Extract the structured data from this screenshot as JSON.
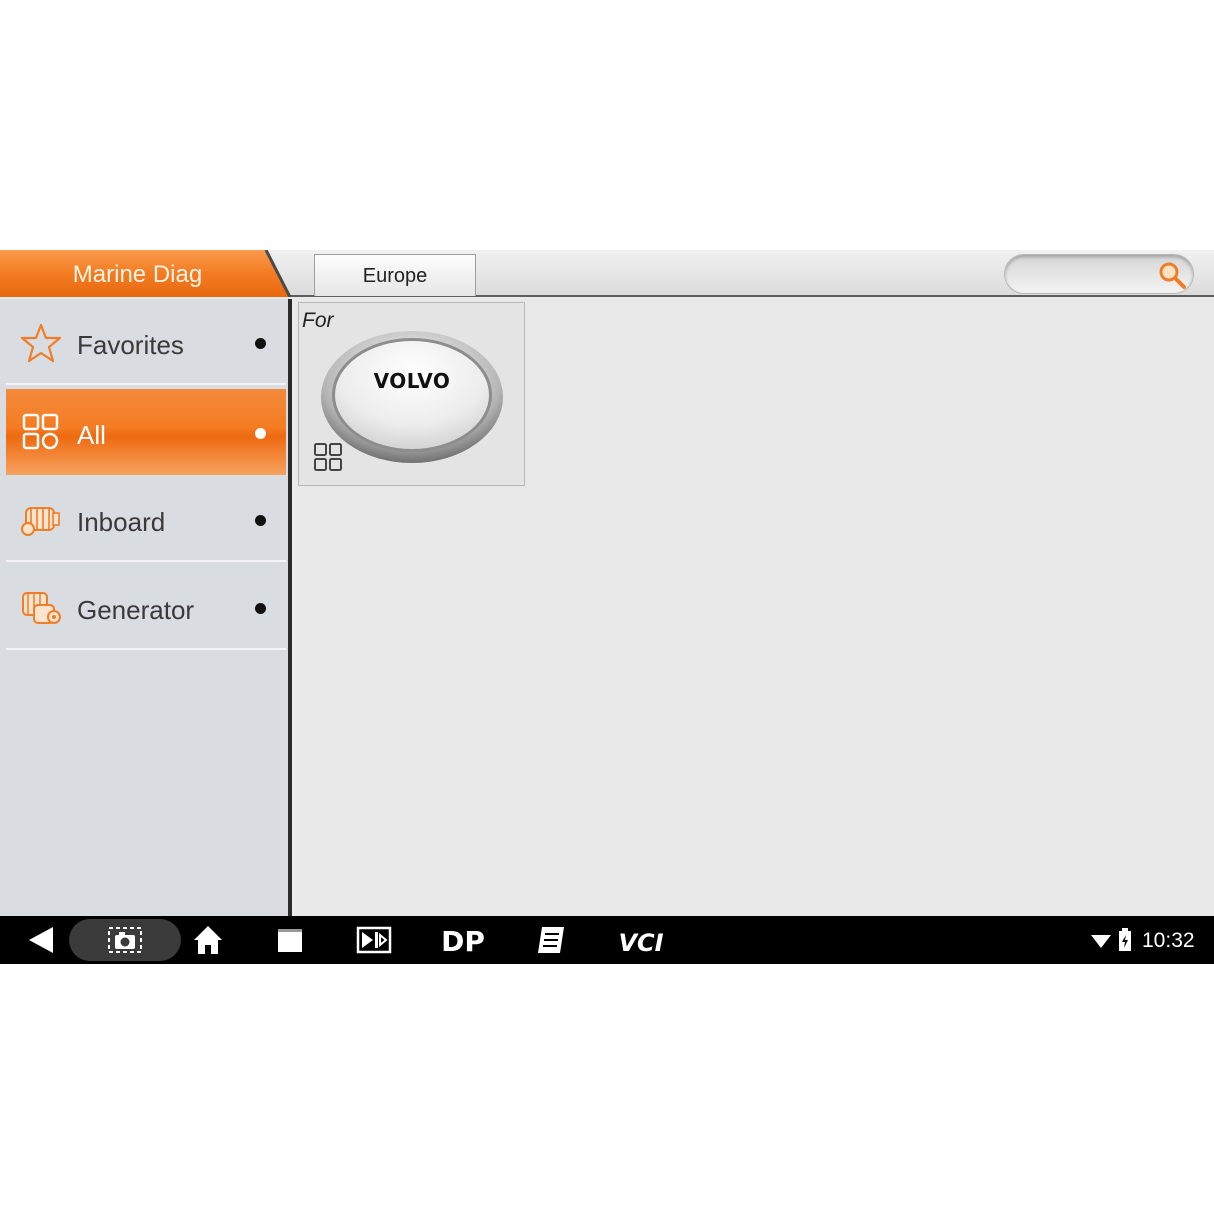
{
  "header": {
    "app_title": "Marine Diag",
    "tabs": [
      {
        "label": "Europe"
      }
    ],
    "search": {
      "placeholder": "",
      "icon": "search-icon"
    }
  },
  "sidebar": {
    "items": [
      {
        "label": "Favorites",
        "icon": "star-icon",
        "active": false
      },
      {
        "label": "All",
        "icon": "grid-icon",
        "active": true
      },
      {
        "label": "Inboard",
        "icon": "engine-icon",
        "active": false
      },
      {
        "label": "Generator",
        "icon": "generator-icon",
        "active": false
      }
    ]
  },
  "content": {
    "cards": [
      {
        "label": "For",
        "brand": "VOLVO",
        "icon": "grid-icon"
      }
    ]
  },
  "navbar": {
    "icons": [
      "back-icon",
      "screenshot-icon",
      "home-icon",
      "recent-apps-icon",
      "media-icon",
      "dp-icon",
      "notes-icon",
      "vci-icon"
    ],
    "dp_label": "DP",
    "vci_label": "VCI",
    "status": {
      "time": "10:32",
      "wifi": "wifi-icon",
      "battery": "battery-icon"
    }
  },
  "colors": {
    "accent": "#f47c22",
    "header_bg": "#e5e5e5",
    "sidebar_bg": "#d9dce0",
    "content_bg": "#e8e8e8",
    "navbar_bg": "#000000"
  }
}
